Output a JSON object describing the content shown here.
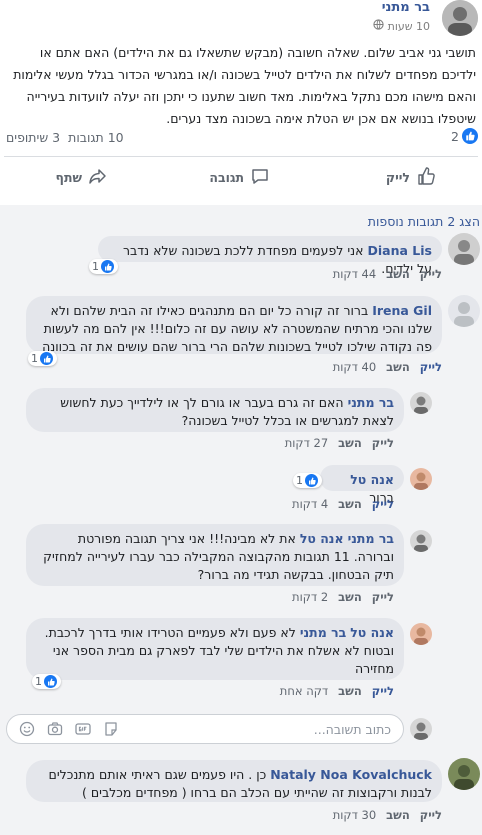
{
  "post": {
    "author": "בר מתני",
    "time": "10 שעות",
    "text": "תושבי גני אביב שלום. שאלה חשובה (מבקש שתשאלו גם את הילדים) האם אתם או ילדיכם מפחדים לשלוח את הילדים לטייל בשכונה ו/או במגרשי הכדור בגלל מעשי אלימות והאם מישהו מכם נתקל באלימות. מאד חשוב שתענו כי יתכן וזה יעלה לוועדות בעירייה שיטפלו בנושא אם אכן יש הטלת אימה בשכונה מצד נערים."
  },
  "stats": {
    "likes": "2",
    "comments": "10 תגובות",
    "shares": "3 שיתופים"
  },
  "actions": {
    "like": "לייק",
    "comment": "תגובה",
    "share": "שתף"
  },
  "more_comments": "הצג 2 תגובות נוספות",
  "comments": [
    {
      "name": "Diana Lis",
      "text": "אני לפעמים מפחדת ללכת בשכונה שלא נדבר על ילדים.",
      "reactions": "1",
      "like": "לייק",
      "reply": "השב",
      "time": "44 דקות"
    },
    {
      "name": "Irena Gil",
      "text": "ברור זה קורה כל יום הם מתנהגים כאילו זה הבית שלהם ולא שלנו והכי מרתיח שהמשטרה לא עושה עם זה כלום!!! אין להם מה לעשות פה נקודה שילכו לטייל בשכונות שלהם הרי ברור שהם עושים את זה בכוונה",
      "reactions": "1",
      "like": "לייק",
      "reply": "השב",
      "time": "40 דקות"
    },
    {
      "name": "בר מתני",
      "text": "האם זה גרם בעבר או גורם לך או לילדייך כעת לחשוש לצאת למגרשים או בכלל לטייל בשכונה?",
      "like": "לייק",
      "reply": "השב",
      "time": "27 דקות"
    },
    {
      "name": "אנה טל",
      "text": "ברור",
      "reactions": "1",
      "like": "לייק",
      "reply": "השב",
      "time": "4 דקות"
    },
    {
      "name": "בר מתני",
      "tag": "אנה טל",
      "text": "את לא מבינה!!! אני צריך תגובה מפורטת וברורה. 11 תגובות מהקבוצה המקבילה כבר עברו לעירייה למחזיק תיק הבטחון. בבקשה תגידי מה ברור?",
      "like": "לייק",
      "reply": "השב",
      "time": "2 דקות"
    },
    {
      "name": "אנה טל",
      "tag": "בר מתני",
      "text": "לא פעם ולא פעמיים הטרידו אותי בדרך לרכבת. ובטוח לא אשלח את הילדים שלי לבד לפארק גם מבית הספר אני מחזירה",
      "reactions": "1",
      "like": "לייק",
      "reply": "השב",
      "time": "דקה אחת"
    },
    {
      "name": "Nataly Noa Kovalchuck",
      "text": "כן . היו פעמים שגם ראיתי אותם מתנכלים לבנות ורקבוצות זה שהייתי עם הכלב הם ברחו ( מפחדים מכלבים )",
      "like": "לייק",
      "reply": "השב",
      "time": "30 דקות"
    }
  ],
  "reply_placeholder": "כתוב תשובה...",
  "colors": {
    "link": "#385898",
    "accent": "#1877f2",
    "bubble": "#e4e6eb",
    "bg": "#f2f3f5"
  }
}
